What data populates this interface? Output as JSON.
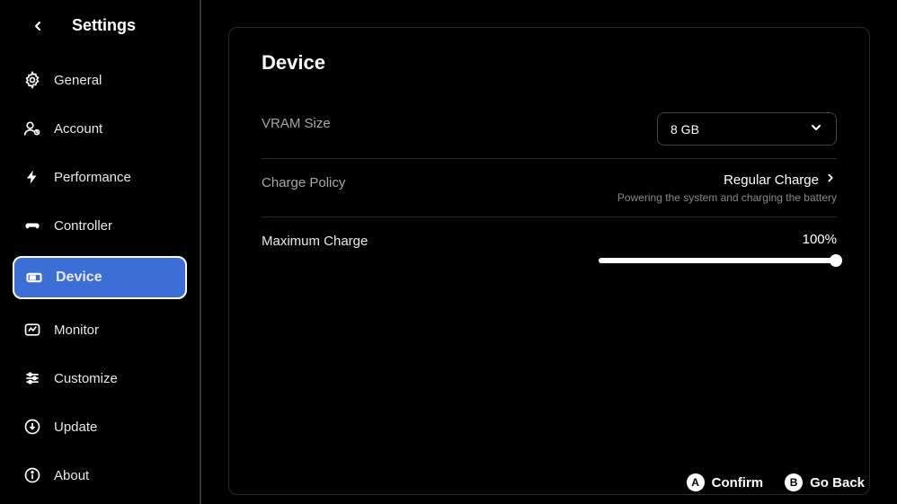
{
  "header": {
    "title": "Settings"
  },
  "sidebar": {
    "items": [
      {
        "label": "General",
        "icon": "gear-icon"
      },
      {
        "label": "Account",
        "icon": "account-icon"
      },
      {
        "label": "Performance",
        "icon": "bolt-icon"
      },
      {
        "label": "Controller",
        "icon": "controller-icon"
      },
      {
        "label": "Device",
        "icon": "device-icon",
        "active": true
      },
      {
        "label": "Monitor",
        "icon": "monitor-icon"
      },
      {
        "label": "Customize",
        "icon": "sliders-icon"
      },
      {
        "label": "Update",
        "icon": "update-icon"
      },
      {
        "label": "About",
        "icon": "info-icon"
      }
    ]
  },
  "panel": {
    "title": "Device",
    "vram": {
      "label": "VRAM Size",
      "value": "8 GB"
    },
    "charge_policy": {
      "label": "Charge Policy",
      "value": "Regular Charge",
      "description": "Powering the system and charging the battery"
    },
    "max_charge": {
      "label": "Maximum Charge",
      "value": "100%",
      "percent": 100
    }
  },
  "footer": {
    "confirm": {
      "glyph": "A",
      "label": "Confirm"
    },
    "back": {
      "glyph": "B",
      "label": "Go Back"
    }
  }
}
